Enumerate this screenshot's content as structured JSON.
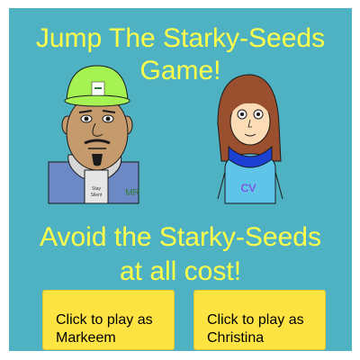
{
  "game": {
    "title_line1": "Jump The Starky-Seeds",
    "title_line2": "Game!",
    "subtitle_line1": "Avoid the Starky-Seeds",
    "subtitle_line2": "at all cost!"
  },
  "characters": {
    "markeem": {
      "initials": "MR",
      "shirt_text_line1": "Stay",
      "shirt_text_line2": "Silent",
      "hat_color": "#a7f253",
      "skin_color": "#c59b6d",
      "shirt_color": "#6c89c6"
    },
    "christina": {
      "initials": "CV",
      "hair_color": "#9a4f2e",
      "skin_color": "#fcdcb6",
      "scarf_color": "#1c3fd4",
      "shirt_color": "#5ec4e8"
    }
  },
  "buttons": {
    "markeem": {
      "line1": "Click to play as",
      "line2": "Markeem"
    },
    "christina": {
      "line1": "Click to play as",
      "line2": "Christina"
    }
  },
  "colors": {
    "background": "#4fb2c3",
    "title_text": "#ffff4a",
    "button": "#fde443"
  }
}
